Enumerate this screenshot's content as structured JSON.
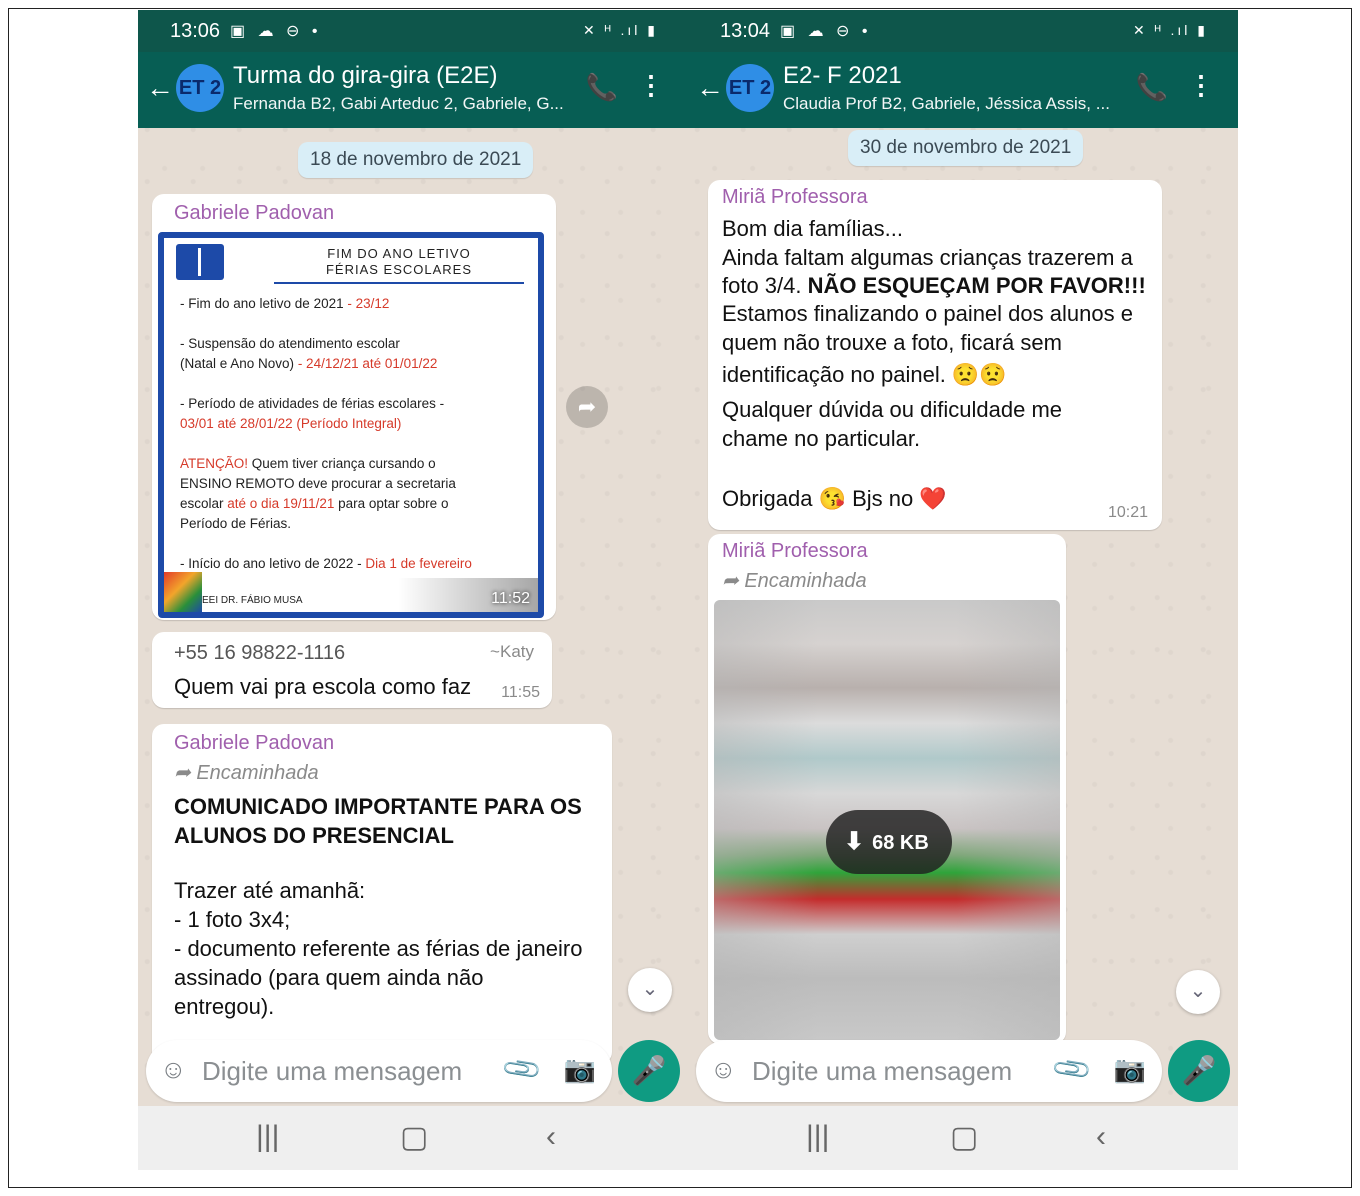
{
  "left": {
    "status": {
      "time": "13:06",
      "icons_left": "▣ ☁ ⊖ •",
      "icons_right": "✕ ᴴ .ıl ▮"
    },
    "header": {
      "avatar": "ET 2",
      "title": "Turma do  gira-gira (E2E)",
      "subtitle": "Fernanda B2, Gabi Arteduc 2, Gabriele, G..."
    },
    "date_chip": "18 de novembro de 2021",
    "msg1": {
      "sender": "Gabriele Padovan",
      "poster": {
        "title_line1": "FIM DO ANO LETIVO",
        "title_line2": "FÉRIAS ESCOLARES",
        "l1": "- Fim do ano letivo de 2021 ",
        "l1_red": "- 23/12",
        "l2": "- Suspensão do atendimento escolar",
        "l3": "(Natal e Ano Novo) ",
        "l3_red": "- 24/12/21 até 01/01/22",
        "l4": "- Período de atividades de férias escolares -",
        "l5_red": "03/01 até 28/01/22 (Período Integral)",
        "l6_red": "ATENÇÃO!",
        "l6": " Quem tiver criança cursando o",
        "l7": "ENSINO REMOTO deve procurar a secretaria",
        "l8": "escolar ",
        "l8_red": "até o dia 19/11/21",
        "l8b": " para optar sobre o",
        "l9": "Período de Férias.",
        "l10": "- Início do ano letivo de 2022 - ",
        "l10_red": "Dia 1 de fevereiro",
        "footer": "EEI DR. FÁBIO MUSA",
        "time": "11:52"
      }
    },
    "msg2": {
      "phone": "+55 16 98822-1116",
      "name": "~Katy",
      "text": "Quem vai pra escola como faz",
      "time": "11:55"
    },
    "msg3": {
      "sender": "Gabriele Padovan",
      "forwarded": "Encaminhada",
      "bold": "COMUNICADO IMPORTANTE PARA OS\nALUNOS DO PRESENCIAL",
      "text": "Trazer até amanhã:\n- 1 foto 3x4;\n- documento referente as férias de janeiro\nassinado (para quem ainda não\nentregou)."
    },
    "input": {
      "placeholder": "Digite uma mensagem"
    }
  },
  "right": {
    "status": {
      "time": "13:04",
      "icons_left": "▣ ☁ ⊖ •",
      "icons_right": "✕ ᴴ .ıl ▮"
    },
    "header": {
      "avatar": "ET 2",
      "title": "E2- F 2021",
      "subtitle": "Claudia Prof B2, Gabriele, Jéssica Assis, ..."
    },
    "date_chip": "30 de novembro de 2021",
    "msg1": {
      "sender": "Miriã Professora",
      "line1": "Bom dia famílias...",
      "line2": "Ainda faltam algumas crianças trazerem a",
      "line3a": "foto 3/4. ",
      "line3b": "NÃO ESQUEÇAM POR FAVOR!!!",
      "line4": "Estamos finalizando o painel dos alunos e",
      "line5": "quem não trouxe a foto, ficará sem",
      "line6": "identificação no painel. 😟😟",
      "line7": "Qualquer dúvida ou dificuldade me",
      "line8": "chame no particular.",
      "line9": "Obrigada 😘 Bjs no ❤️",
      "time": "10:21"
    },
    "msg2": {
      "sender": "Miriã Professora",
      "forwarded": "Encaminhada",
      "size": "68 KB"
    },
    "input": {
      "placeholder": "Digite uma mensagem"
    }
  },
  "icons": {
    "back": "←",
    "call": "📞",
    "menu": "⋮",
    "emoji": "☺",
    "clip": "📎",
    "camera": "📷",
    "mic": "🎤",
    "forward": "➦",
    "scroll": "⌄",
    "nav_recent": "|||",
    "nav_home": "▢",
    "nav_back": "‹"
  },
  "colors": {
    "header": "#075e54",
    "accent": "#0f9b82",
    "sender": "#a05fad"
  }
}
